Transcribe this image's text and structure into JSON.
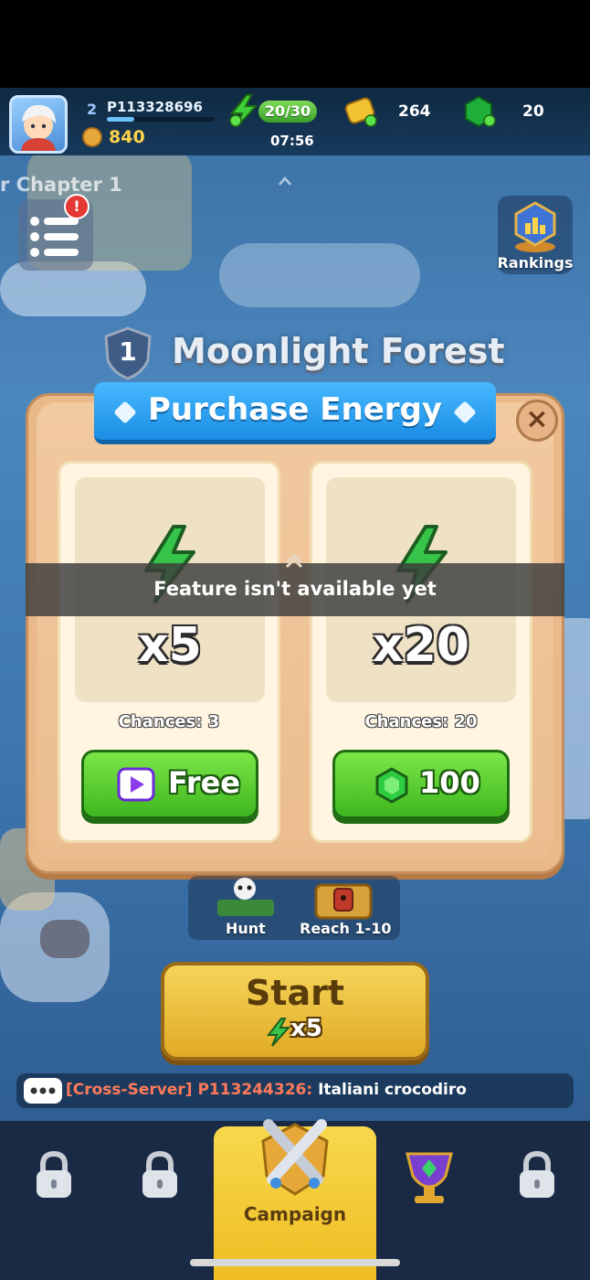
{
  "player": {
    "level": "2",
    "id": "P113328696",
    "trophies": "840"
  },
  "resources": {
    "energy": "20/30",
    "energy_timer": "07:56",
    "gold": "264",
    "gems": "20"
  },
  "side": {
    "chapter_hint": "r Chapter 1",
    "rankings_label": "Rankings",
    "menu_alert": "!"
  },
  "stage": {
    "number": "1",
    "title": "Moonlight Forest"
  },
  "dialog": {
    "title": "Purchase Energy",
    "close_symbol": "×",
    "options": [
      {
        "quantity": "x5",
        "chances": "Chances: 3",
        "button_label": "Free",
        "button_icon": "video-ad-icon"
      },
      {
        "quantity": "x20",
        "chances": "Chances: 20",
        "button_label": "100",
        "button_icon": "gem-icon"
      }
    ]
  },
  "toast": {
    "message": "Feature isn't available yet"
  },
  "quests": [
    {
      "label": "Hunt"
    },
    {
      "label": "Reach 1-10"
    }
  ],
  "start": {
    "label": "Start",
    "cost": "x5"
  },
  "chat": {
    "channel": "[Cross-Server]",
    "sender": "P113244326:",
    "message": "Italiani crocodiro"
  },
  "nav": {
    "active_label": "Campaign"
  },
  "colors": {
    "energy_green": "#3fb71f",
    "banner_blue": "#1b8de3",
    "panel_tan": "#e9b98a",
    "start_gold": "#f5d45a",
    "chat_channel": "#ff7a5a"
  }
}
